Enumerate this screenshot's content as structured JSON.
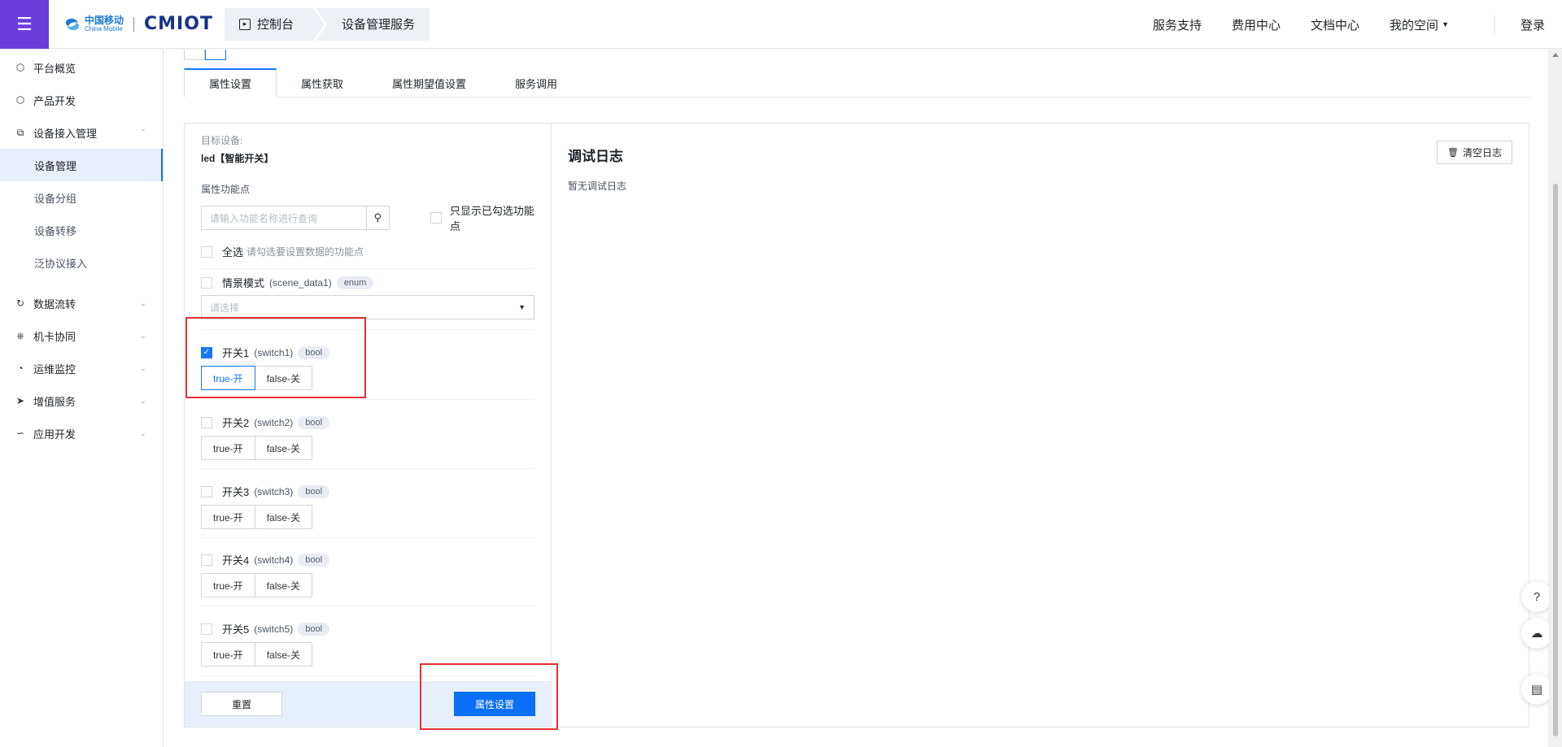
{
  "colors": {
    "brand_purple": "#6d3ddb",
    "primary": "#1677ff",
    "highlight": "#e53030"
  },
  "header": {
    "menu_icon": "menu-icon",
    "logo": {
      "zh": "中国移动",
      "en": "China Mobile",
      "product": "CMIOT"
    },
    "breadcrumb": {
      "home": "控制台",
      "current": "设备管理服务"
    },
    "nav": {
      "support": "服务支持",
      "billing": "费用中心",
      "docs": "文档中心",
      "space": "我的空间",
      "login": "登录"
    }
  },
  "sidebar": {
    "overview": "平台概览",
    "product_dev": "产品开发",
    "device_access": "设备接入管理",
    "device_access_children": [
      "设备管理",
      "设备分组",
      "设备转移",
      "泛协议接入"
    ],
    "data_flow": "数据流转",
    "card_coop": "机卡协同",
    "ops_monitor": "运维监控",
    "value_added": "增值服务",
    "app_dev": "应用开发"
  },
  "tabs": [
    "属性设置",
    "属性获取",
    "属性期望值设置",
    "服务调用"
  ],
  "left_panel": {
    "target_label": "目标设备:",
    "target_value": "led【智能开关】",
    "func_label": "属性功能点",
    "search_placeholder": "请输入功能名称进行查询",
    "show_checked": "只显示已勾选功能点",
    "select_all": "全选",
    "select_all_hint": "请勾选要设置数据的功能点",
    "scene": {
      "name": "情景模式",
      "id": "(scene_data1)",
      "type": "enum",
      "placeholder": "请选择"
    },
    "switches": [
      {
        "name": "开关1",
        "id": "(switch1)",
        "type": "bool",
        "true_label": "true-开",
        "false_label": "false-关",
        "checked": true,
        "selected": "true"
      },
      {
        "name": "开关2",
        "id": "(switch2)",
        "type": "bool",
        "true_label": "true-开",
        "false_label": "false-关",
        "checked": false,
        "selected": null
      },
      {
        "name": "开关3",
        "id": "(switch3)",
        "type": "bool",
        "true_label": "true-开",
        "false_label": "false-关",
        "checked": false,
        "selected": null
      },
      {
        "name": "开关4",
        "id": "(switch4)",
        "type": "bool",
        "true_label": "true-开",
        "false_label": "false-关",
        "checked": false,
        "selected": null
      },
      {
        "name": "开关5",
        "id": "(switch5)",
        "type": "bool",
        "true_label": "true-开",
        "false_label": "false-关",
        "checked": false,
        "selected": null
      }
    ],
    "reset": "重置",
    "submit": "属性设置"
  },
  "log_panel": {
    "title": "调试日志",
    "clear": "清空日志",
    "empty": "暂无调试日志"
  }
}
